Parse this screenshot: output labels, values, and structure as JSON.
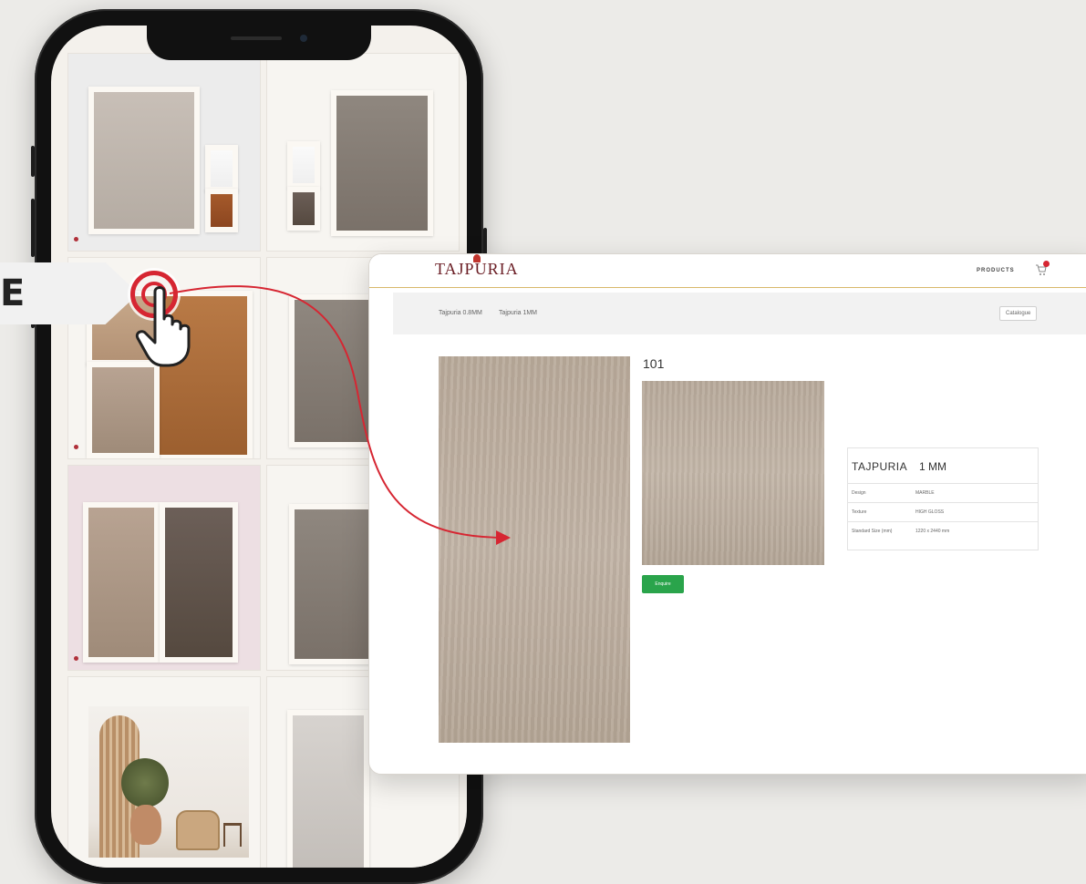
{
  "callout": {
    "letter": "E"
  },
  "site": {
    "logo": "TAJPURIA",
    "logo_tagline": "",
    "nav_products": "PRODUCTS",
    "breadcrumbs": [
      "Tajpuria 0.8MM",
      "Tajpuria 1MM"
    ],
    "catalogue_button": "Catalogue"
  },
  "product": {
    "code": "101",
    "enquire_button": "Enquire",
    "spec": {
      "brand": "TAJPURIA",
      "thickness": "1 MM",
      "rows": [
        {
          "key": "Design",
          "value": "MARBLE"
        },
        {
          "key": "Texture",
          "value": "HIGH GLOSS"
        },
        {
          "key": "Standard Size (mm)",
          "value": "1220 x 2440 mm"
        }
      ]
    }
  },
  "colors": {
    "accent_red": "#d62632",
    "enquire_green": "#2aa44b",
    "header_rule": "#d8b86a",
    "logo_maroon": "#6a1d24"
  },
  "icons": [
    "cart-icon",
    "tap-hand-icon",
    "arrow-curve"
  ]
}
